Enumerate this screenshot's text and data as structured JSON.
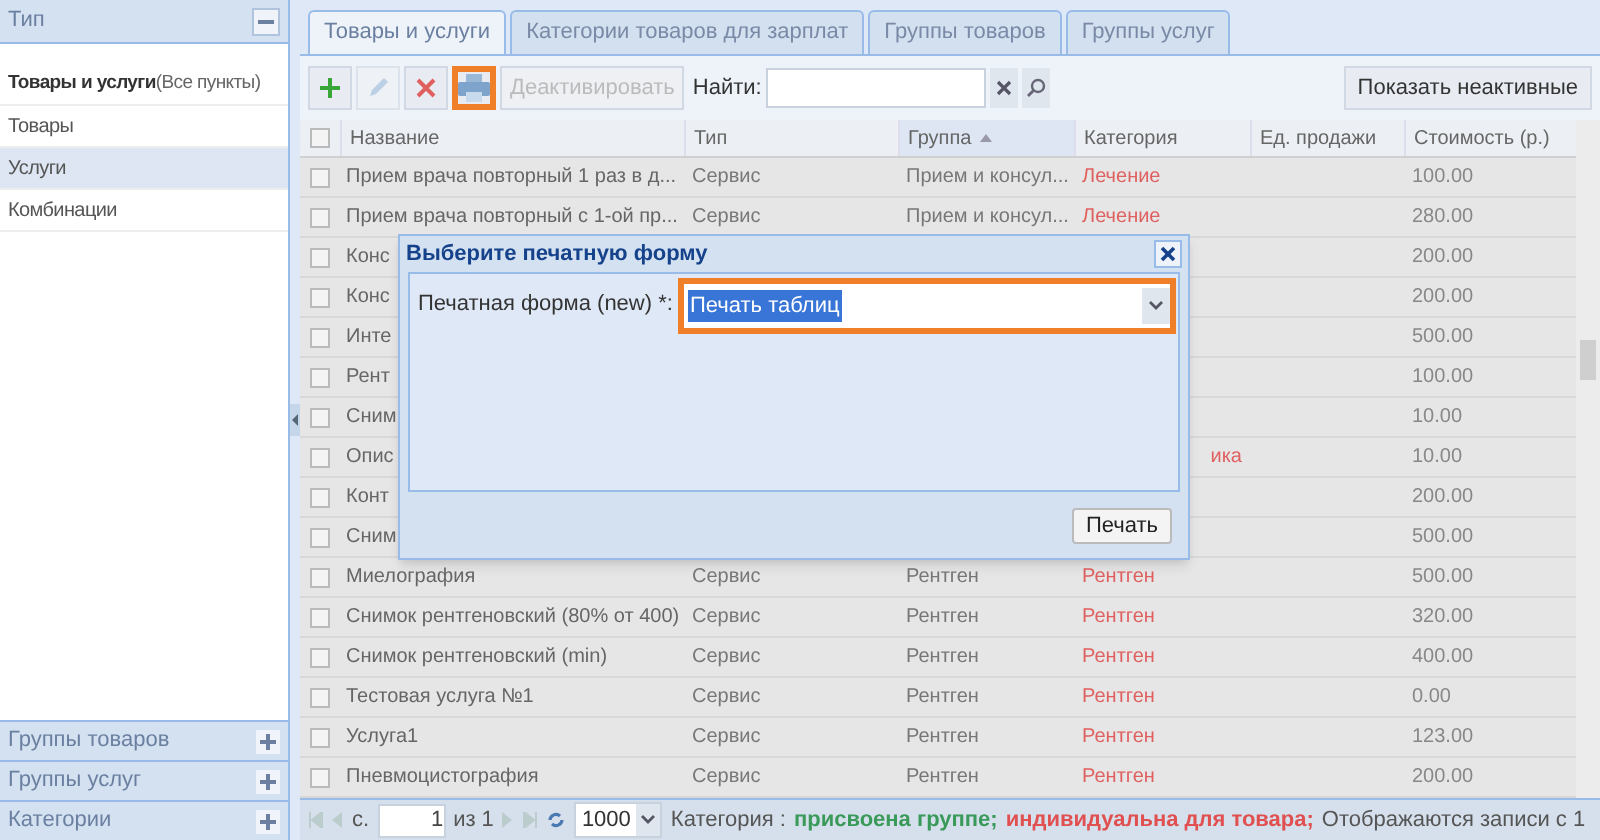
{
  "sidebar": {
    "title": "Тип",
    "items": [
      {
        "label": "Товары и услуги",
        "suffix": "(Все пункты)",
        "selected": false
      },
      {
        "label": "Товары",
        "selected": false
      },
      {
        "label": "Услуги",
        "selected": true
      },
      {
        "label": "Комбинации",
        "selected": false
      }
    ],
    "sections": [
      "Группы товаров",
      "Группы услуг",
      "Категории"
    ]
  },
  "tabs": [
    {
      "label": "Товары и услуги",
      "selected": true
    },
    {
      "label": "Категории товаров для зарплат",
      "selected": false
    },
    {
      "label": "Группы товаров",
      "selected": false
    },
    {
      "label": "Группы услуг",
      "selected": false
    }
  ],
  "toolbar": {
    "buttons": [
      {
        "kind": "add",
        "disabled": false,
        "highlighted": false
      },
      {
        "kind": "edit",
        "disabled": true,
        "highlighted": false
      },
      {
        "kind": "delete",
        "disabled": false,
        "highlighted": false
      },
      {
        "kind": "print",
        "disabled": false,
        "highlighted": true
      }
    ],
    "deactivate": {
      "label": "Деактивировать",
      "disabled": true
    },
    "search_label": "Найти:",
    "show_inactive": "Показать неактивные"
  },
  "table": {
    "select_all_checked": false,
    "columns": [
      {
        "label": "Название",
        "sorted": false
      },
      {
        "label": "Тип",
        "sorted": false
      },
      {
        "label": "Группа",
        "sorted": true
      },
      {
        "label": "Категория",
        "sorted": false
      },
      {
        "label": "Ед. продажи",
        "sorted": false
      },
      {
        "label": "Стоимость (р.)",
        "sorted": false
      }
    ],
    "rows": [
      {
        "kind": "full",
        "checked": false,
        "name": "Прием врача повторный 1 раз в д...",
        "type": "Сервис",
        "group": "Прием и консул...",
        "category": "Лечение",
        "cost": "100.00"
      },
      {
        "kind": "full",
        "checked": false,
        "name": "Прием врача повторный с 1-ой пр...",
        "type": "Сервис",
        "group": "Прием и консул...",
        "category": "Лечение",
        "cost": "280.00"
      },
      {
        "kind": "covered",
        "checked": false,
        "name": "Конс",
        "cost": "200.00"
      },
      {
        "kind": "covered",
        "checked": false,
        "name": "Конс",
        "cost": "200.00"
      },
      {
        "kind": "covered",
        "checked": false,
        "name": "Инте",
        "cost": "500.00"
      },
      {
        "kind": "covered",
        "checked": false,
        "name": "Рент",
        "cost": "100.00"
      },
      {
        "kind": "covered",
        "checked": false,
        "name": "Сним",
        "cost": "10.00"
      },
      {
        "kind": "covered",
        "checked": false,
        "name": "Опис",
        "category": "ика",
        "cost": "10.00"
      },
      {
        "kind": "covered",
        "checked": false,
        "name": "Конт",
        "cost": "200.00"
      },
      {
        "kind": "covered",
        "checked": false,
        "name": "Сним",
        "cost": "500.00"
      },
      {
        "kind": "full",
        "checked": false,
        "name": "Миелография",
        "type": "Сервис",
        "group": "Рентген",
        "category": "Рентген",
        "cost": "500.00"
      },
      {
        "kind": "full",
        "checked": false,
        "name": "Снимок рентгеновский (80% от 400)",
        "type": "Сервис",
        "group": "Рентген",
        "category": "Рентген",
        "cost": "320.00"
      },
      {
        "kind": "full",
        "checked": false,
        "name": "Снимок рентгеновский (min)",
        "type": "Сервис",
        "group": "Рентген",
        "category": "Рентген",
        "cost": "400.00"
      },
      {
        "kind": "full",
        "checked": false,
        "name": "Тестовая услуга №1",
        "type": "Сервис",
        "group": "Рентген",
        "category": "Рентген",
        "cost": "0.00"
      },
      {
        "kind": "full",
        "checked": false,
        "name": "Услуга1",
        "type": "Сервис",
        "group": "Рентген",
        "category": "Рентген",
        "cost": "123.00"
      },
      {
        "kind": "full",
        "checked": false,
        "name": "Пневмоцистография",
        "type": "Сервис",
        "group": "Рентген",
        "category": "Рентген",
        "cost": "200.00"
      }
    ]
  },
  "pagination": {
    "page_label": "с.",
    "page": "1",
    "of": "из 1",
    "page_size": "1000",
    "legend_label": "Категория :",
    "legend": [
      {
        "label": "присвоена группе;",
        "color": "#3a9a5a"
      },
      {
        "label": "индивидуальна для товара;",
        "color": "#e05050"
      }
    ],
    "status": "Отображаются записи с 1"
  },
  "dialog": {
    "title": "Выберите печатную форму",
    "field_label": "Печатная форма (new) *:",
    "field_value": "Печать таблиц",
    "field_highlighted": true,
    "button": "Печать"
  }
}
